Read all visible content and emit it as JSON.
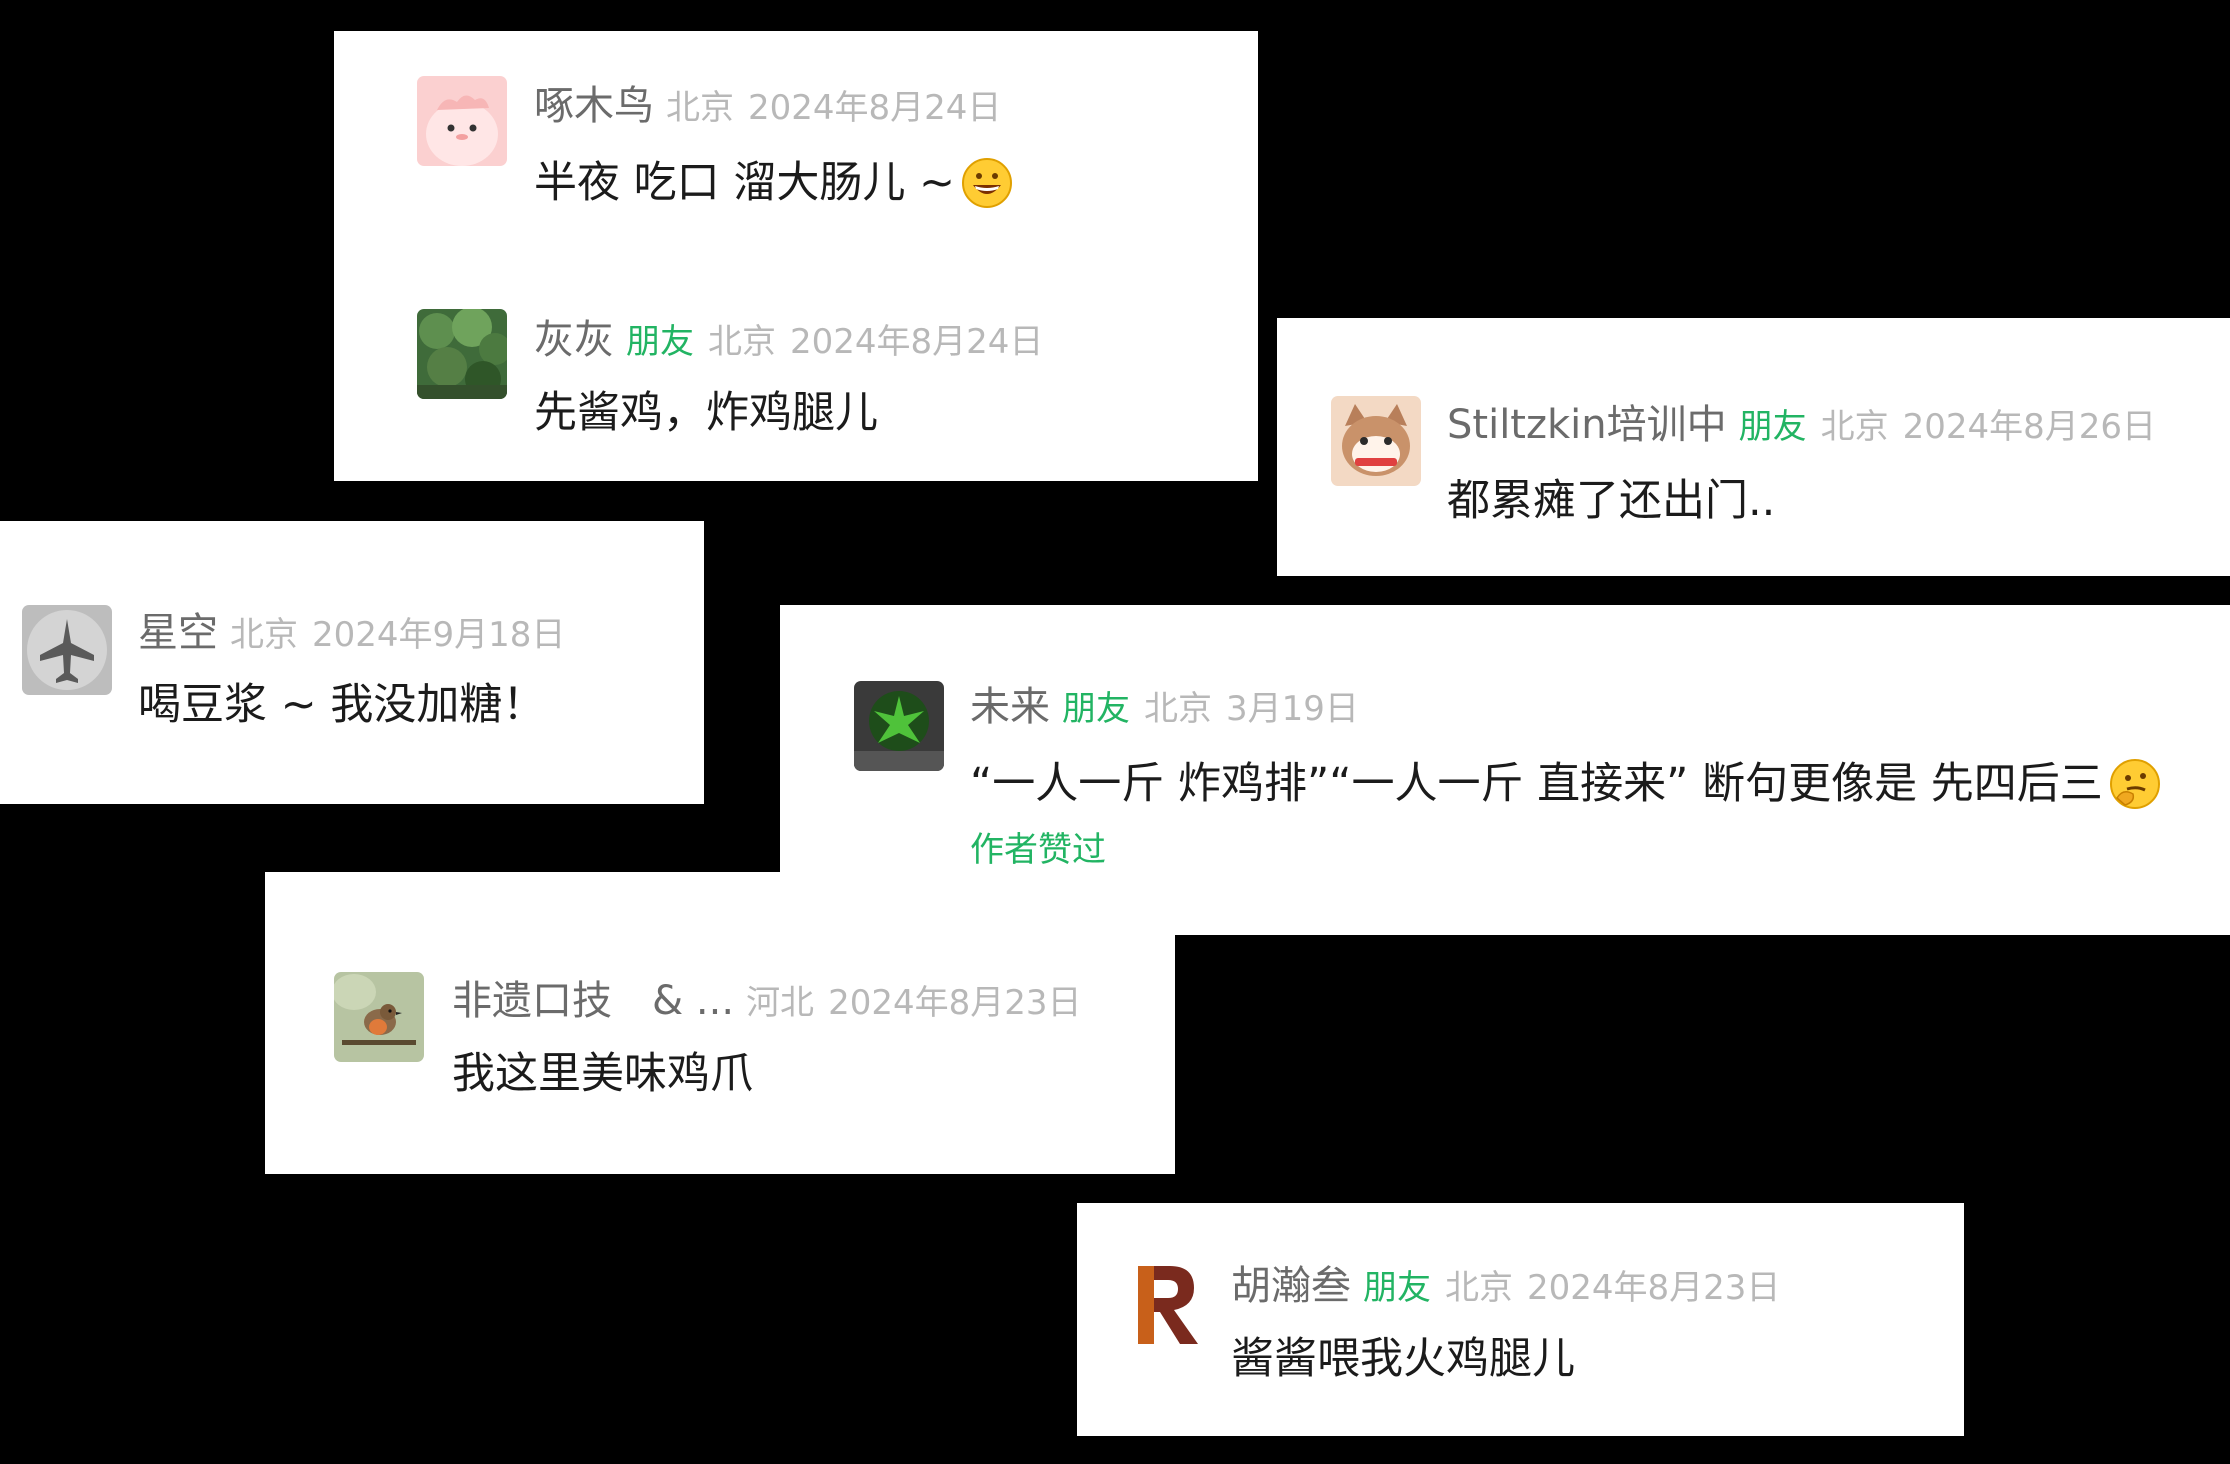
{
  "comments": [
    {
      "avatar": "pink-cartoon-avatar",
      "name": "啄木鸟",
      "location": "北京",
      "date": "2024年8月24日",
      "text": "半夜 吃口 溜大肠儿 ~",
      "emoji": "grinning-face-emoji"
    },
    {
      "avatar": "green-trees-avatar",
      "name": "灰灰",
      "badge": "朋友",
      "location": "北京",
      "date": "2024年8月24日",
      "text": "先酱鸡，炸鸡腿儿"
    },
    {
      "avatar": "cat-cartoon-avatar",
      "name": "Stiltzkin培训中",
      "badge": "朋友",
      "location": "北京",
      "date": "2024年8月26日",
      "text": "都累瘫了还出门.."
    },
    {
      "avatar": "airplane-avatar",
      "name": "星空",
      "location": "北京",
      "date": "2024年9月18日",
      "text": "喝豆浆 ~ 我没加糖！"
    },
    {
      "avatar": "green-plant-avatar",
      "name": "未来",
      "badge": "朋友",
      "location": "北京",
      "date": "3月19日",
      "text": "“一人一斤 炸鸡排”“一人一斤 直接来” 断句更像是 先四后三",
      "emoji": "thinking-face-emoji",
      "liked_label": "作者赞过"
    },
    {
      "avatar": "bird-avatar",
      "name": "非遗口技　& ...",
      "location": "河北",
      "date": "2024年8月23日",
      "text": "我这里美味鸡爪"
    },
    {
      "avatar": "letter-r-avatar",
      "name": "胡瀚叁",
      "badge": "朋友",
      "location": "北京",
      "date": "2024年8月23日",
      "text": "酱酱喂我火鸡腿儿"
    }
  ],
  "colors": {
    "background": "#000000",
    "card": "#ffffff",
    "name": "#6b6b6b",
    "friend_badge": "#22b463",
    "meta": "#b8b8b8",
    "text": "#1b1b1b"
  }
}
